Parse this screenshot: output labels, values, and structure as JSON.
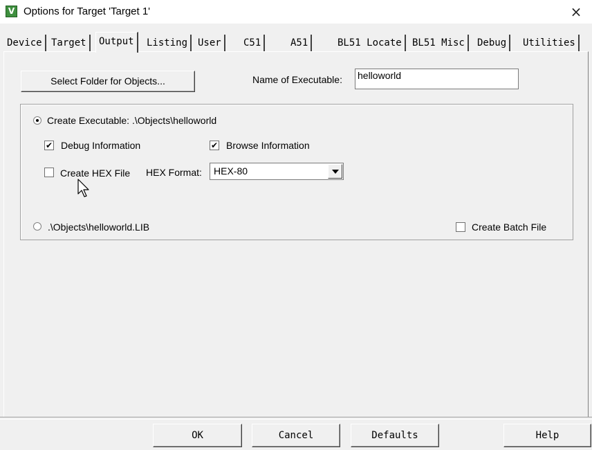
{
  "window": {
    "title": "Options for Target 'Target 1'",
    "icon": "keil-app-icon",
    "icon_glyph": "V",
    "close_glyph": "×"
  },
  "tabs": [
    {
      "label": "Device"
    },
    {
      "label": "Target"
    },
    {
      "label": "Output",
      "active": true
    },
    {
      "label": "Listing"
    },
    {
      "label": "User"
    },
    {
      "label": "C51"
    },
    {
      "label": "A51"
    },
    {
      "label": "BL51 Locate"
    },
    {
      "label": "BL51 Misc"
    },
    {
      "label": "Debug"
    },
    {
      "label": "Utilities"
    }
  ],
  "output": {
    "select_folder_label": "Select Folder for Objects...",
    "name_of_executable_label": "Name of Executable:",
    "name_of_executable_value": "helloworld",
    "create_executable_label": "Create Executable:  .\\Objects\\helloworld",
    "create_executable_checked": true,
    "debug_info_label": "Debug Information",
    "debug_info_checked": true,
    "browse_info_label": "Browse Information",
    "browse_info_checked": true,
    "create_hex_label": "Create HEX File",
    "create_hex_checked": false,
    "hex_format_label": "HEX Format:",
    "hex_format_value": "HEX-80",
    "create_library_label": ".\\Objects\\helloworld.LIB",
    "create_library_checked": false,
    "create_batch_label": "Create Batch File",
    "create_batch_checked": false,
    "check_glyph": "✔"
  },
  "footer": {
    "ok": "OK",
    "cancel": "Cancel",
    "defaults": "Defaults",
    "help": "Help"
  }
}
